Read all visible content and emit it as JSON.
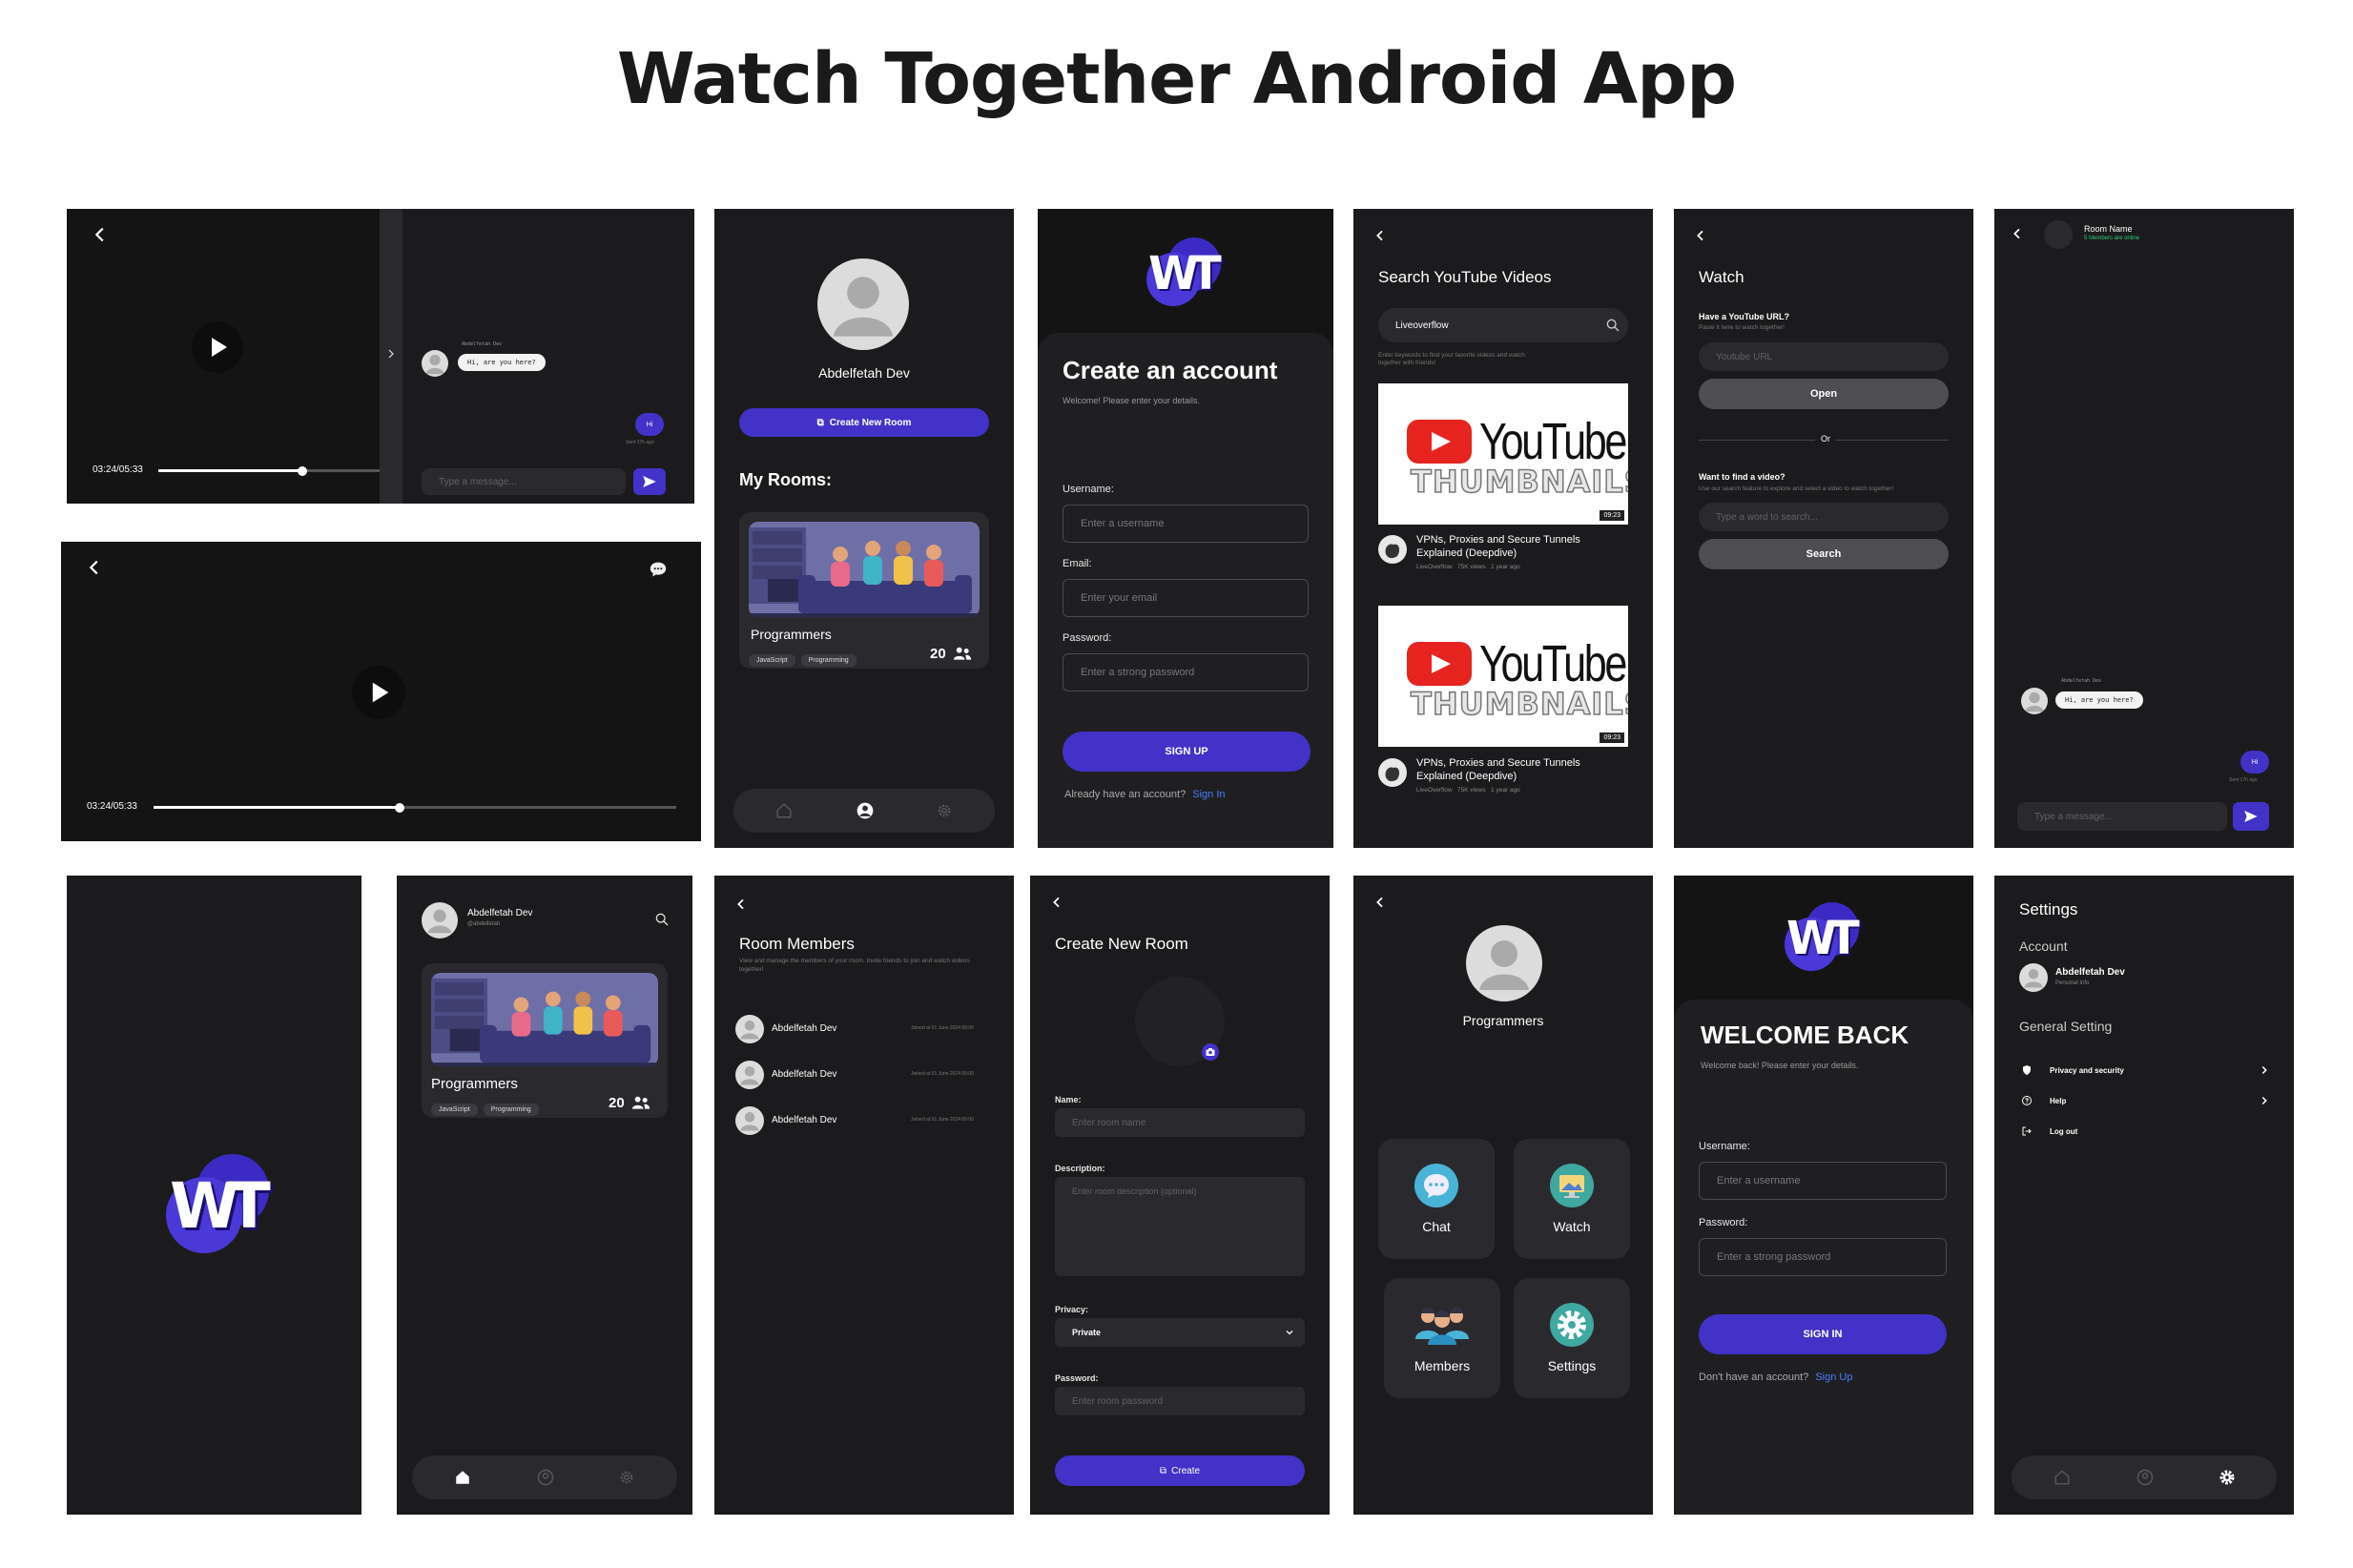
{
  "page_title": "Watch Together Android App",
  "colors": {
    "accent": "#4232c8",
    "screen_bg": "#1b1b1d",
    "link": "#4a7dff",
    "online": "#2ecc71"
  },
  "player": {
    "time": "03:24/05:33",
    "progress": 0.56,
    "chat_sender": "Abdelfetah Dev",
    "chat_message": "Hi, are you here?",
    "my_message": "Hi",
    "sent_time": "Sent 17h ago",
    "input_placeholder": "Type a message..."
  },
  "profile_home": {
    "name": "Abdelfetah Dev",
    "create_room": "Create New Room",
    "my_rooms": "My Rooms:",
    "room_name": "Programmers",
    "tags": [
      "JavaScript",
      "Programming"
    ],
    "members": "20"
  },
  "signup": {
    "logo_text": "WT",
    "title": "Create an account",
    "subtitle": "Welcome! Please enter your details.",
    "username_label": "Username:",
    "username_ph": "Enter a username",
    "email_label": "Email:",
    "email_ph": "Enter your email",
    "password_label": "Password:",
    "password_ph": "Enter a strong password",
    "button": "SIGN UP",
    "footer": "Already have an account?",
    "footer_link": "Sign In"
  },
  "search": {
    "title": "Search YouTube Videos",
    "query": "Liveoverflow",
    "hint": "Enter keywords to find your favorite videos and watch together with friends!",
    "results": [
      {
        "title": "VPNs, Proxies and Secure Tunnels Explained (Deepdive)",
        "channel": "LiveOverflow",
        "views": "75K views",
        "age": "1 year ago",
        "duration": "09:23",
        "yt_word": "YouTube",
        "thumb_word": "THUMBNAILS"
      },
      {
        "title": "VPNs, Proxies and Secure Tunnels Explained (Deepdive)",
        "channel": "LiveOverflow",
        "views": "75K views",
        "age": "1 year ago",
        "duration": "09:23",
        "yt_word": "YouTube",
        "thumb_word": "THUMBNAILS"
      }
    ]
  },
  "watch": {
    "title": "Watch",
    "url_q": "Have a YouTube URL?",
    "url_hint": "Paste it here to watch together!",
    "url_ph": "Youtube URL",
    "open": "Open",
    "or": "Or",
    "find_q": "Want to find a video?",
    "find_hint": "Use our search feature to explore and select a video to watch together!",
    "find_ph": "Type a word to search...",
    "search": "Search"
  },
  "chat_room": {
    "room_name": "Room Name",
    "online": "5 Members are online",
    "sender": "Abdelfetah Dev",
    "message": "Hi, are you here?",
    "my_message": "Hi",
    "sent": "Sent 17h ago",
    "input_ph": "Type a message..."
  },
  "splash": {
    "logo_text": "WT"
  },
  "home": {
    "name": "Abdelfetah Dev",
    "handle": "@abdelfetah",
    "room_name": "Programmers",
    "tags": [
      "JavaScript",
      "Programming"
    ],
    "members": "20"
  },
  "members": {
    "title": "Room Members",
    "subtitle": "View and manage the members of your room. Invite friends to join and watch videos together!",
    "list": [
      {
        "name": "Abdelfetah Dev",
        "joined": "Joined at 01 June 2024 00:00"
      },
      {
        "name": "Abdelfetah Dev",
        "joined": "Joined at 01 June 2024 00:00"
      },
      {
        "name": "Abdelfetah Dev",
        "joined": "Joined at 01 June 2024 00:00"
      }
    ]
  },
  "create_room": {
    "title": "Create New Room",
    "name_label": "Name:",
    "name_ph": "Enter room name",
    "desc_label": "Description:",
    "desc_ph": "Enter room description (optional)",
    "privacy_label": "Privacy:",
    "privacy_value": "Private",
    "password_label": "Password:",
    "password_ph": "Enter room password",
    "button": "Create"
  },
  "room_menu": {
    "room_name": "Programmers",
    "tiles": [
      "Chat",
      "Watch",
      "Members",
      "Settings"
    ]
  },
  "signin": {
    "logo_text": "WT",
    "title": "WELCOME BACK",
    "subtitle": "Welcome back! Please enter your details.",
    "username_label": "Username:",
    "username_ph": "Enter a username",
    "password_label": "Password:",
    "password_ph": "Enter a strong password",
    "button": "SIGN IN",
    "footer": "Don't have an account?",
    "footer_link": "Sign Up"
  },
  "settings": {
    "title": "Settings",
    "account_label": "Account",
    "name": "Abdelfetah Dev",
    "info": "Personal Info",
    "general_label": "General Setting",
    "items": [
      "Privacy and security",
      "Help",
      "Log out"
    ]
  }
}
